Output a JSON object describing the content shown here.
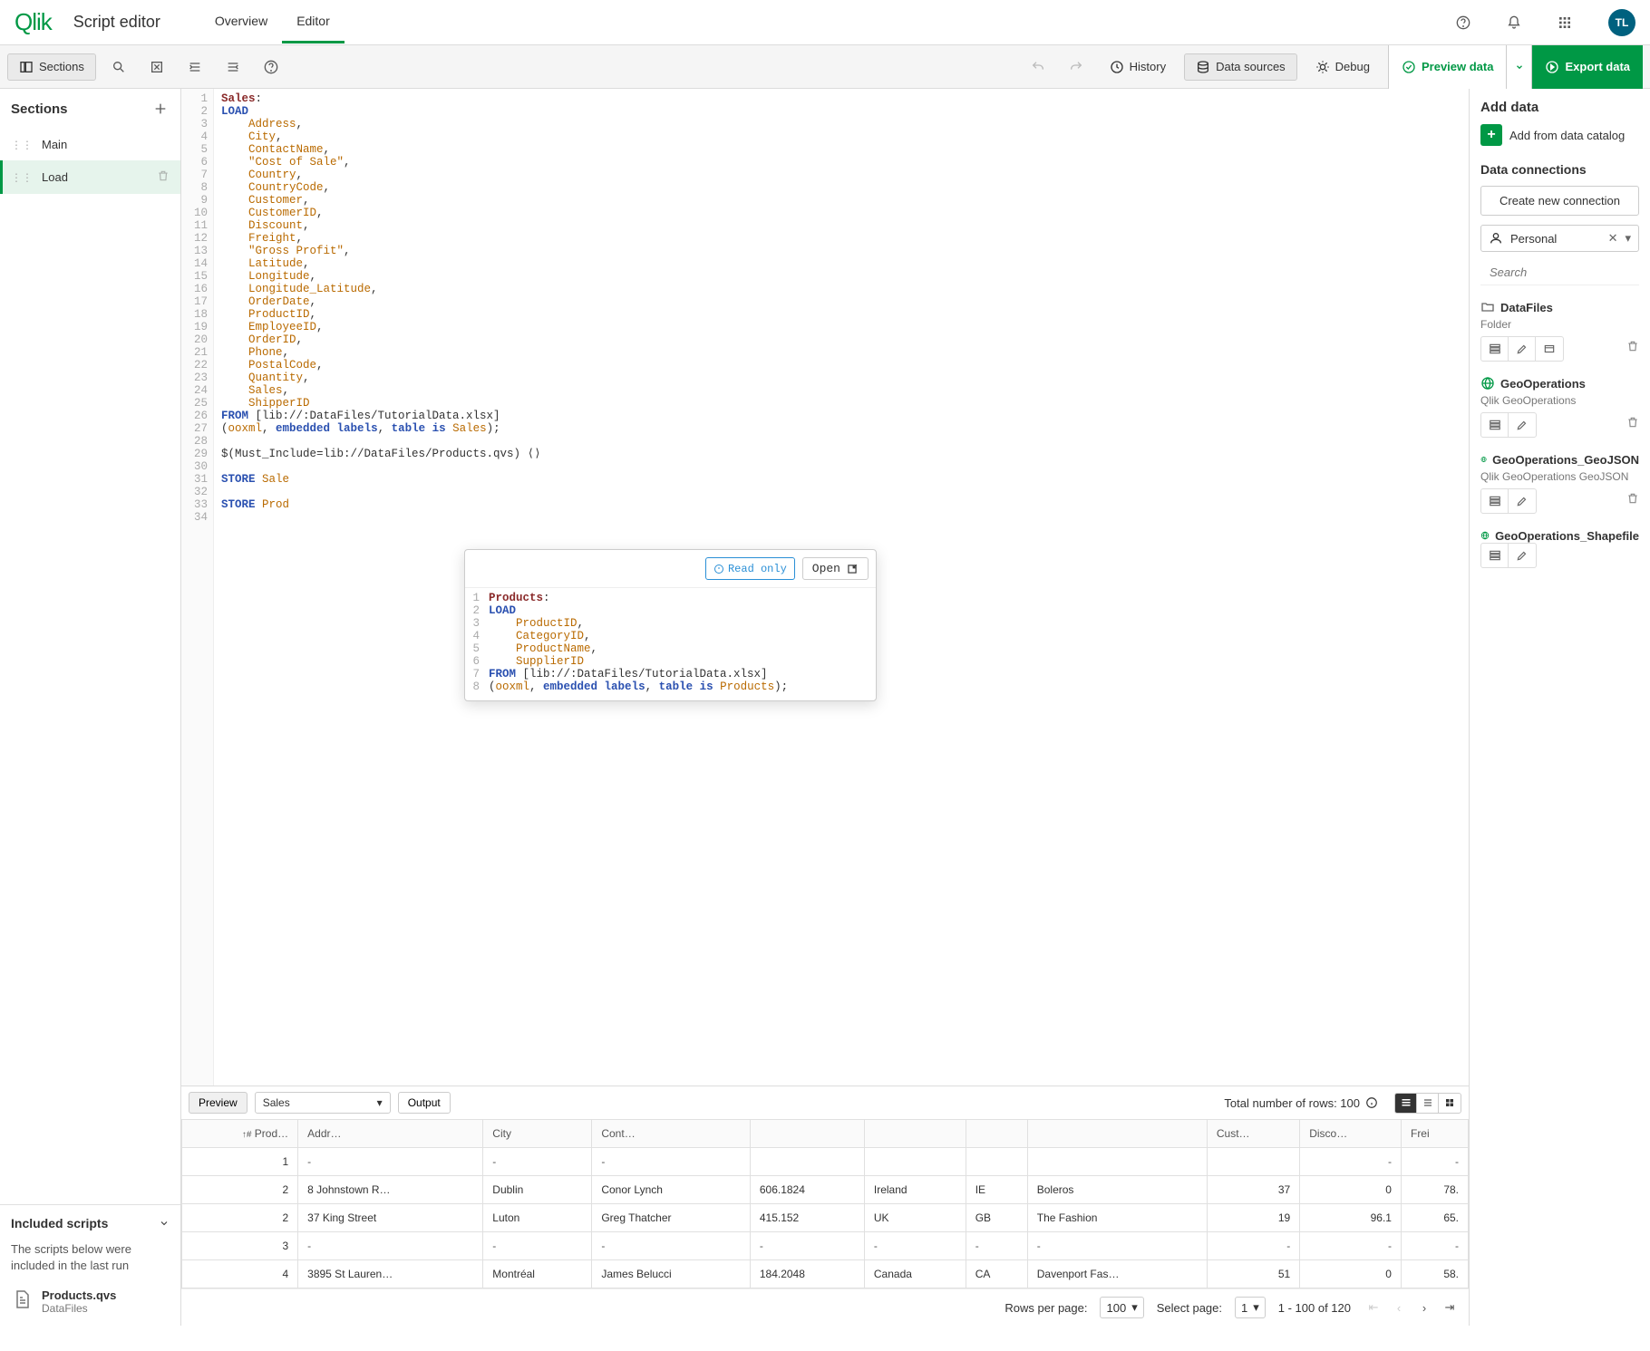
{
  "header": {
    "logo": "Qlik",
    "title": "Script editor",
    "tabs": [
      "Overview",
      "Editor"
    ],
    "active_tab": 1,
    "avatar": "TL"
  },
  "toolbar": {
    "sections": "Sections",
    "history": "History",
    "datasources": "Data sources",
    "debug": "Debug",
    "preview": "Preview data",
    "export": "Export data"
  },
  "sections_panel": {
    "title": "Sections",
    "items": [
      {
        "label": "Main",
        "active": false
      },
      {
        "label": "Load",
        "active": true
      }
    ],
    "included_title": "Included scripts",
    "included_text": "The scripts below were included in the last run",
    "included_file": {
      "name": "Products.qvs",
      "sub": "DataFiles"
    }
  },
  "code": {
    "lines": [
      {
        "n": 1,
        "tokens": [
          {
            "t": "Sales",
            "c": "kw-label"
          },
          {
            "t": ":",
            "c": ""
          }
        ]
      },
      {
        "n": 2,
        "tokens": [
          {
            "t": "LOAD",
            "c": "kw-load"
          }
        ]
      },
      {
        "n": 3,
        "tokens": [
          {
            "t": "    Address",
            "c": "kw-field"
          },
          {
            "t": ",",
            "c": ""
          }
        ]
      },
      {
        "n": 4,
        "tokens": [
          {
            "t": "    City",
            "c": "kw-field"
          },
          {
            "t": ",",
            "c": ""
          }
        ]
      },
      {
        "n": 5,
        "tokens": [
          {
            "t": "    ContactName",
            "c": "kw-field"
          },
          {
            "t": ",",
            "c": ""
          }
        ]
      },
      {
        "n": 6,
        "tokens": [
          {
            "t": "    \"Cost of Sale\"",
            "c": "kw-str"
          },
          {
            "t": ",",
            "c": ""
          }
        ]
      },
      {
        "n": 7,
        "tokens": [
          {
            "t": "    Country",
            "c": "kw-field"
          },
          {
            "t": ",",
            "c": ""
          }
        ]
      },
      {
        "n": 8,
        "tokens": [
          {
            "t": "    CountryCode",
            "c": "kw-field"
          },
          {
            "t": ",",
            "c": ""
          }
        ]
      },
      {
        "n": 9,
        "tokens": [
          {
            "t": "    Customer",
            "c": "kw-field"
          },
          {
            "t": ",",
            "c": ""
          }
        ]
      },
      {
        "n": 10,
        "tokens": [
          {
            "t": "    CustomerID",
            "c": "kw-field"
          },
          {
            "t": ",",
            "c": ""
          }
        ]
      },
      {
        "n": 11,
        "tokens": [
          {
            "t": "    Discount",
            "c": "kw-field"
          },
          {
            "t": ",",
            "c": ""
          }
        ]
      },
      {
        "n": 12,
        "tokens": [
          {
            "t": "    Freight",
            "c": "kw-field"
          },
          {
            "t": ",",
            "c": ""
          }
        ]
      },
      {
        "n": 13,
        "tokens": [
          {
            "t": "    \"Gross Profit\"",
            "c": "kw-str"
          },
          {
            "t": ",",
            "c": ""
          }
        ]
      },
      {
        "n": 14,
        "tokens": [
          {
            "t": "    Latitude",
            "c": "kw-field"
          },
          {
            "t": ",",
            "c": ""
          }
        ]
      },
      {
        "n": 15,
        "tokens": [
          {
            "t": "    Longitude",
            "c": "kw-field"
          },
          {
            "t": ",",
            "c": ""
          }
        ]
      },
      {
        "n": 16,
        "tokens": [
          {
            "t": "    Longitude_Latitude",
            "c": "kw-field"
          },
          {
            "t": ",",
            "c": ""
          }
        ]
      },
      {
        "n": 17,
        "tokens": [
          {
            "t": "    OrderDate",
            "c": "kw-field"
          },
          {
            "t": ",",
            "c": ""
          }
        ]
      },
      {
        "n": 18,
        "tokens": [
          {
            "t": "    ProductID",
            "c": "kw-field"
          },
          {
            "t": ",",
            "c": ""
          }
        ]
      },
      {
        "n": 19,
        "tokens": [
          {
            "t": "    EmployeeID",
            "c": "kw-field"
          },
          {
            "t": ",",
            "c": ""
          }
        ]
      },
      {
        "n": 20,
        "tokens": [
          {
            "t": "    OrderID",
            "c": "kw-field"
          },
          {
            "t": ",",
            "c": ""
          }
        ]
      },
      {
        "n": 21,
        "tokens": [
          {
            "t": "    Phone",
            "c": "kw-field"
          },
          {
            "t": ",",
            "c": ""
          }
        ]
      },
      {
        "n": 22,
        "tokens": [
          {
            "t": "    PostalCode",
            "c": "kw-field"
          },
          {
            "t": ",",
            "c": ""
          }
        ]
      },
      {
        "n": 23,
        "tokens": [
          {
            "t": "    Quantity",
            "c": "kw-field"
          },
          {
            "t": ",",
            "c": ""
          }
        ]
      },
      {
        "n": 24,
        "tokens": [
          {
            "t": "    Sales",
            "c": "kw-field"
          },
          {
            "t": ",",
            "c": ""
          }
        ]
      },
      {
        "n": 25,
        "tokens": [
          {
            "t": "    ShipperID",
            "c": "kw-field"
          }
        ]
      },
      {
        "n": 26,
        "tokens": [
          {
            "t": "FROM",
            "c": "kw-load"
          },
          {
            "t": " [lib://:DataFiles/TutorialData.xlsx]",
            "c": ""
          }
        ]
      },
      {
        "n": 27,
        "tokens": [
          {
            "t": "(",
            "c": ""
          },
          {
            "t": "ooxml",
            "c": "kw-field"
          },
          {
            "t": ", ",
            "c": ""
          },
          {
            "t": "embedded labels",
            "c": "kw-load"
          },
          {
            "t": ", ",
            "c": ""
          },
          {
            "t": "table is",
            "c": "kw-load"
          },
          {
            "t": " ",
            "c": ""
          },
          {
            "t": "Sales",
            "c": "kw-field"
          },
          {
            "t": ");",
            "c": ""
          }
        ]
      },
      {
        "n": 28,
        "tokens": [
          {
            "t": "",
            "c": ""
          }
        ]
      },
      {
        "n": 29,
        "tokens": [
          {
            "t": "$(Must_Include=lib://DataFiles/Products.qvs) ",
            "c": ""
          },
          {
            "t": "⟨⟩",
            "c": "kw-br"
          }
        ]
      },
      {
        "n": 30,
        "tokens": [
          {
            "t": "",
            "c": ""
          }
        ]
      },
      {
        "n": 31,
        "tokens": [
          {
            "t": "STORE",
            "c": "kw-load"
          },
          {
            "t": " ",
            "c": ""
          },
          {
            "t": "Sale",
            "c": "kw-field"
          }
        ]
      },
      {
        "n": 32,
        "tokens": [
          {
            "t": "",
            "c": ""
          }
        ]
      },
      {
        "n": 33,
        "tokens": [
          {
            "t": "STORE",
            "c": "kw-load"
          },
          {
            "t": " ",
            "c": ""
          },
          {
            "t": "Prod",
            "c": "kw-field"
          }
        ]
      },
      {
        "n": 34,
        "tokens": [
          {
            "t": "",
            "c": ""
          }
        ]
      }
    ]
  },
  "popup": {
    "readonly": "Read only",
    "open": "Open",
    "lines": [
      {
        "n": 1,
        "tokens": [
          {
            "t": "Products",
            "c": "kw-label"
          },
          {
            "t": ":",
            "c": ""
          }
        ]
      },
      {
        "n": 2,
        "tokens": [
          {
            "t": "LOAD",
            "c": "kw-load"
          }
        ]
      },
      {
        "n": 3,
        "tokens": [
          {
            "t": "    ProductID",
            "c": "kw-field"
          },
          {
            "t": ",",
            "c": ""
          }
        ]
      },
      {
        "n": 4,
        "tokens": [
          {
            "t": "    CategoryID",
            "c": "kw-field"
          },
          {
            "t": ",",
            "c": ""
          }
        ]
      },
      {
        "n": 5,
        "tokens": [
          {
            "t": "    ProductName",
            "c": "kw-field"
          },
          {
            "t": ",",
            "c": ""
          }
        ]
      },
      {
        "n": 6,
        "tokens": [
          {
            "t": "    SupplierID",
            "c": "kw-field"
          }
        ]
      },
      {
        "n": 7,
        "tokens": [
          {
            "t": "FROM",
            "c": "kw-load"
          },
          {
            "t": " [lib://:DataFiles/TutorialData.xlsx]",
            "c": ""
          }
        ]
      },
      {
        "n": 8,
        "tokens": [
          {
            "t": "(",
            "c": ""
          },
          {
            "t": "ooxml",
            "c": "kw-field"
          },
          {
            "t": ", ",
            "c": ""
          },
          {
            "t": "embedded labels",
            "c": "kw-load"
          },
          {
            "t": ", ",
            "c": ""
          },
          {
            "t": "table is",
            "c": "kw-load"
          },
          {
            "t": " ",
            "c": ""
          },
          {
            "t": "Products",
            "c": "kw-field"
          },
          {
            "t": ");",
            "c": ""
          }
        ]
      }
    ]
  },
  "right": {
    "add_data": "Add data",
    "add_catalog": "Add from data catalog",
    "connections_title": "Data connections",
    "create": "Create new connection",
    "personal": "Personal",
    "search_placeholder": "Search",
    "conns": [
      {
        "name": "DataFiles",
        "sub": "Folder",
        "globe": false
      },
      {
        "name": "GeoOperations",
        "sub": "Qlik GeoOperations",
        "globe": true
      },
      {
        "name": "GeoOperations_GeoJSON",
        "sub": "Qlik GeoOperations GeoJSON",
        "globe": true
      },
      {
        "name": "GeoOperations_Shapefile",
        "sub": "",
        "globe": true
      }
    ]
  },
  "preview": {
    "preview_btn": "Preview",
    "table_select": "Sales",
    "output_btn": "Output",
    "total": "Total number of rows: 100",
    "columns": [
      "Prod…",
      "Addr…",
      "City",
      "Cont…",
      "",
      "",
      "",
      "",
      "Cust…",
      "Disco…",
      "Frei"
    ],
    "rows": [
      {
        "r": [
          "1",
          "-",
          "-",
          "-",
          "",
          "",
          "",
          "",
          "",
          "-",
          "-"
        ]
      },
      {
        "r": [
          "2",
          "8 Johnstown R…",
          "Dublin",
          "Conor Lynch",
          "606.1824",
          "Ireland",
          "IE",
          "Boleros",
          "37",
          "0",
          "78."
        ]
      },
      {
        "r": [
          "2",
          "37 King Street",
          "Luton",
          "Greg Thatcher",
          "415.152",
          "UK",
          "GB",
          "The Fashion",
          "19",
          "96.1",
          "65."
        ]
      },
      {
        "r": [
          "3",
          "-",
          "-",
          "-",
          "-",
          "-",
          "-",
          "-",
          "-",
          "-",
          "-"
        ]
      },
      {
        "r": [
          "4",
          "3895 St Lauren…",
          "Montréal",
          "James Belucci",
          "184.2048",
          "Canada",
          "CA",
          "Davenport Fas…",
          "51",
          "0",
          "58."
        ]
      }
    ],
    "rows_per_page_label": "Rows per page:",
    "rows_per_page": "100",
    "select_page_label": "Select page:",
    "select_page": "1",
    "range": "1 - 100 of 120"
  }
}
